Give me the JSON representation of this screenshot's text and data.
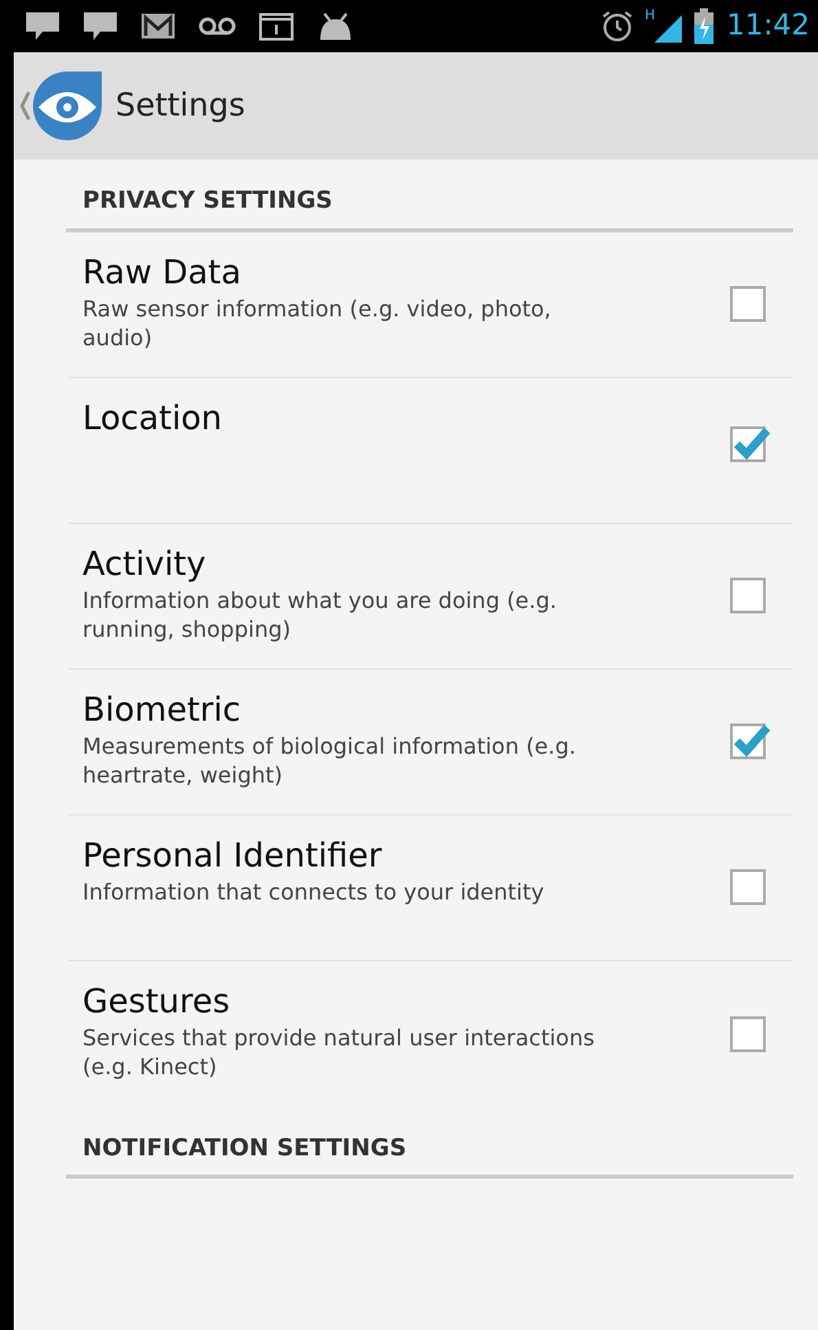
{
  "status_bar": {
    "time": "11:42",
    "network": "H"
  },
  "action_bar": {
    "title": "Settings"
  },
  "sections": [
    {
      "title": "PRIVACY SETTINGS",
      "items": [
        {
          "title": "Raw Data",
          "summary": "Raw sensor information (e.g. video, photo, audio)",
          "checked": false
        },
        {
          "title": "Location",
          "checked": true
        },
        {
          "title": "Activity",
          "summary": "Information about what you are doing (e.g. running, shopping)",
          "checked": false
        },
        {
          "title": "Biometric",
          "summary": "Measurements of biological information (e.g. heartrate, weight)",
          "checked": true
        },
        {
          "title": "Personal Identifier",
          "summary": "Information that connects to your identity",
          "checked": false
        },
        {
          "title": "Gestures",
          "summary": "Services that provide natural user interactions (e.g. Kinect)",
          "checked": false
        }
      ]
    },
    {
      "title": "NOTIFICATION SETTINGS"
    }
  ]
}
